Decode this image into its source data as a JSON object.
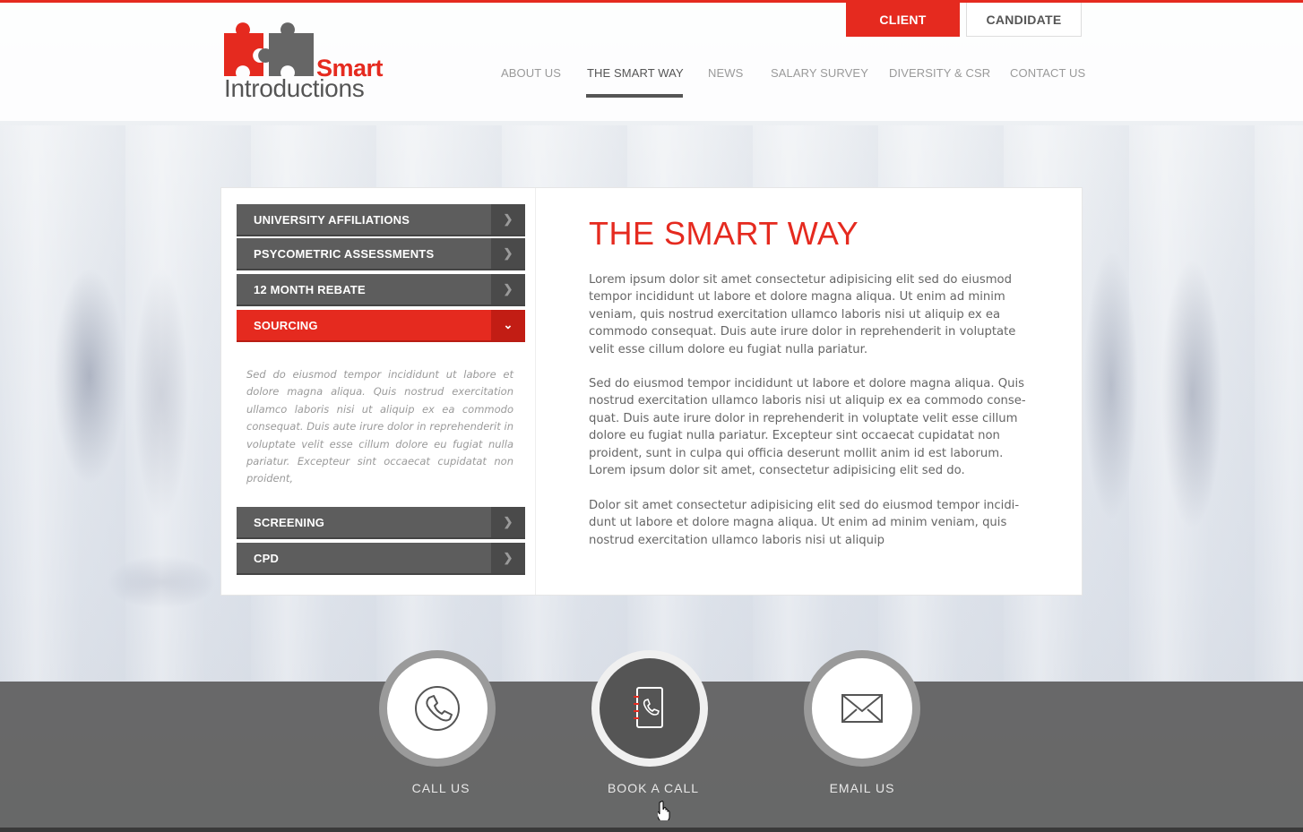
{
  "header": {
    "logo": {
      "line1": "Smart",
      "line2": "Introductions"
    },
    "toggle": {
      "client": "CLIENT",
      "candidate": "CANDIDATE"
    },
    "nav": [
      {
        "label": "ABOUT US"
      },
      {
        "label": "THE SMART WAY",
        "active": true
      },
      {
        "label": "NEWS"
      },
      {
        "label": "SALARY SURVEY"
      },
      {
        "label": "DIVERSITY & CSR"
      },
      {
        "label": "CONTACT US"
      }
    ]
  },
  "sidebar": {
    "items": [
      {
        "label": "UNIVERSITY AFFILIATIONS"
      },
      {
        "label": "PSYCOMETRIC ASSESSMENTS"
      },
      {
        "label": "12 MONTH REBATE"
      },
      {
        "label": "SOURCING",
        "open": true
      },
      {
        "label": "SCREENING"
      },
      {
        "label": "CPD"
      }
    ],
    "open_body": "Sed do eiusmod tempor incididunt ut labore et dolore magna aliqua. Quis nostrud exercitation ullamco laboris nisi ut aliquip ex ea commodo consequat. Duis aute irure dolor in reprehenderit in voluptate velit esse cillum dolore eu fugiat nulla pariatur. Excepteur sint occaecat cupidatat non proident,"
  },
  "main": {
    "title": "THE SMART WAY",
    "paragraphs": [
      "Lorem ipsum dolor sit amet consectetur adipisicing elit sed do eiusmod tempor incididunt ut labore et dolore magna aliqua. Ut enim ad minim veniam, quis nostrud exercitation ullamco laboris nisi ut aliquip ex ea commodo consequat. Duis aute irure dolor in reprehenderit in voluptate velit esse cillum dolore eu fugiat nulla pariatur.",
      "Sed do eiusmod tempor incididunt ut labore et dolore magna aliqua. Quis nostrud exercitation ullamco laboris nisi ut aliquip ex ea commodo conse-quat. Duis aute irure dolor in reprehenderit in voluptate velit esse cillum dolore eu fugiat nulla pariatur. Excepteur sint occaecat cupidatat non proident, sunt in culpa qui officia deserunt mollit anim id est laborum. Lorem ipsum dolor sit amet, consectetur adipisicing elit sed do.",
      "Dolor sit amet consectetur adipisicing elit sed do eiusmod tempor incidi-dunt ut labore et dolore magna aliqua. Ut enim ad minim veniam, quis nostrud exercitation ullamco laboris nisi ut aliquip"
    ]
  },
  "footer": {
    "actions": [
      {
        "label": "CALL US",
        "icon": "phone-icon"
      },
      {
        "label": "BOOK A CALL",
        "icon": "address-book-icon",
        "active": true
      },
      {
        "label": "EMAIL US",
        "icon": "envelope-icon"
      }
    ]
  },
  "colors": {
    "accent": "#e52a1f",
    "dark_gray": "#5d5d5d",
    "footer": "#5f5f5f"
  }
}
